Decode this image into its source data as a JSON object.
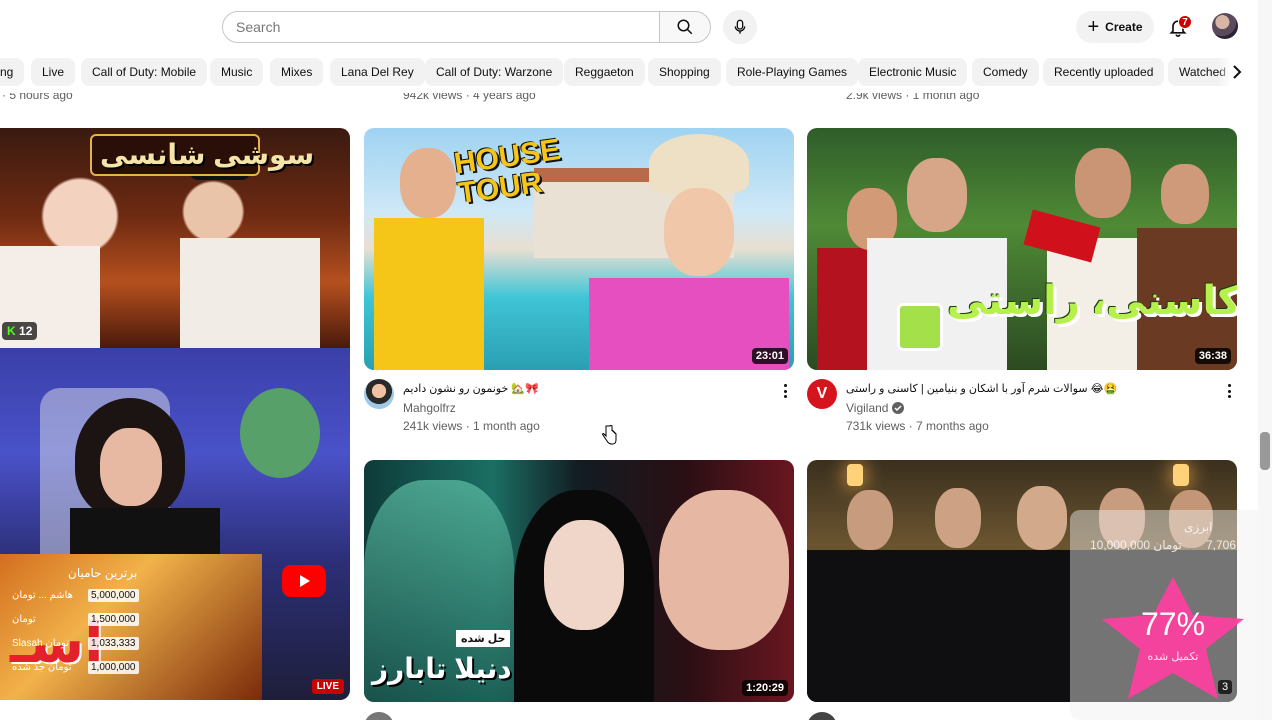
{
  "search": {
    "placeholder": "Search"
  },
  "header": {
    "create_label": "Create",
    "notification_count": "7"
  },
  "chips": [
    "ng",
    "Live",
    "Call of Duty: Mobile",
    "Music",
    "Mixes",
    "Lana Del Rey",
    "Call of Duty: Warzone",
    "Reggaeton",
    "Shopping",
    "Role-Playing Games",
    "Electronic Music",
    "Comedy",
    "Recently uploaded",
    "Watched"
  ],
  "cut_meta": [
    "· 5 hours ago",
    "942k views · 4 years ago",
    "2.9k views · 1 month ago"
  ],
  "videos": [
    {
      "thumb_text": "سوشی شانسی",
      "badge": "12"
    },
    {
      "thumb_text": "HOUSE TOUR",
      "duration": "23:01",
      "title": "خونمون رو نشون دادیم 🏡🎀",
      "channel": "Mahgolfrz",
      "stats": "241k views · 1 month ago"
    },
    {
      "thumb_text": "کاسنی، راستی",
      "duration": "36:38",
      "title": "سوالات شرم آور با اشکان و بنیامین | کاسنی و راستی 😂🤮",
      "channel": "Vigiland",
      "stats": "731k views · 7 months ago"
    },
    {
      "live_label": "LIVE"
    },
    {
      "thumb_text": "دنیلا تابارز",
      "thumb_sub": "حل شده",
      "duration": "1:20:29"
    },
    {
      "duration": "3"
    }
  ],
  "stream_overlay": {
    "rows": [
      {
        "name": "برترین حامیان",
        "amount": ""
      },
      {
        "name": "هاشم ... تومان",
        "amount": "5,000,000"
      },
      {
        "name": "تومان",
        "amount": "1,500,000"
      },
      {
        "name": "Slasah تومان",
        "amount": "1,033,333"
      },
      {
        "name": "تومان جذ شده",
        "amount": "1,000,000"
      }
    ]
  },
  "goal_widget": {
    "percent": "77%",
    "subtitle": "تکمیل شده",
    "goal_label": "ابرزی",
    "goal_amount": "10,000,000 تومان",
    "raised": "7,706"
  },
  "colors": {
    "accent_red": "#cc0000",
    "star_pink": "#ff3fa0"
  }
}
